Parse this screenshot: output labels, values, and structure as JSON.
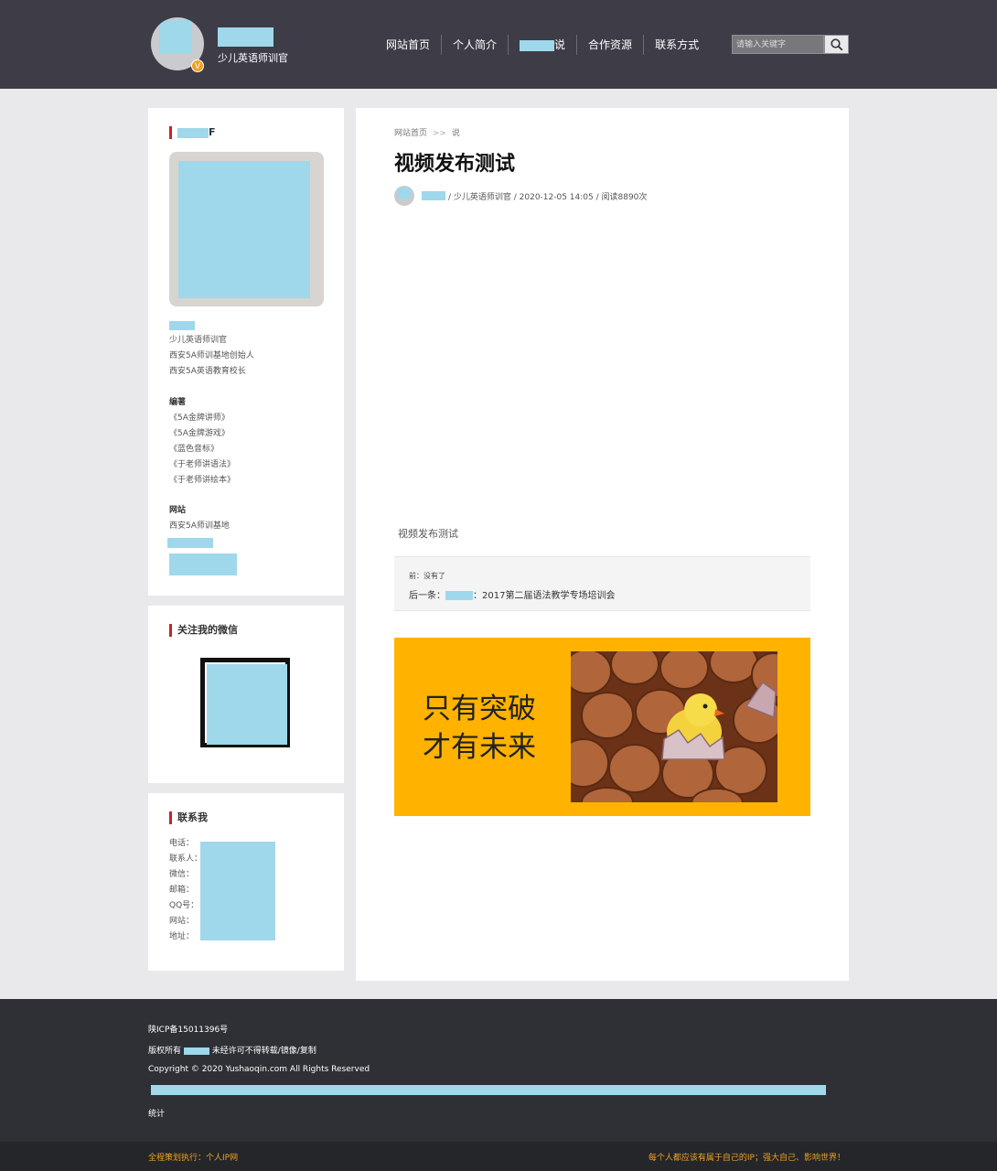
{
  "header": {
    "subtitle": "少儿英语师训官",
    "badge": "V",
    "nav": [
      "网站首页",
      "个人简介",
      "说",
      "合作资源",
      "联系方式"
    ],
    "search_placeholder": "请输入关键字"
  },
  "sidebar": {
    "profile": {
      "title_tail": "F",
      "lines": [
        "少儿英语师训官",
        "西安5A师训基地创始人",
        "西安5A英语教育校长"
      ],
      "books_heading": "编著",
      "books": [
        "《5A金牌讲师》",
        "《5A金牌游戏》",
        "《蓝色音标》",
        "《于老师讲语法》",
        "《于老师讲绘本》"
      ],
      "sites_heading": "网站",
      "sites": [
        "西安5A师训基地"
      ]
    },
    "wechat": {
      "title": "关注我的微信"
    },
    "contact": {
      "title": "联系我",
      "labels": [
        "电话：",
        "联系人：",
        "微信：",
        "邮箱：",
        "QQ号：",
        "网站：",
        "地址："
      ]
    }
  },
  "article": {
    "breadcrumb_home": "网站首页",
    "breadcrumb_sep": ">>",
    "breadcrumb_current": "说",
    "title": "视频发布测试",
    "meta": "/ 少儿英语师训官 / 2020-12-05 14:05 / 阅读8890次",
    "caption": "视频发布测试",
    "prev": "前：没有了",
    "next_label": "后一条：",
    "next_title": "：2017第二届语法教学专场培训会",
    "banner_line1": "只有突破",
    "banner_line2": "才有未来"
  },
  "footer": {
    "icp": "陕ICP备15011396号",
    "rights_prefix": "版权所有",
    "rights_suffix": "未经许可不得转载/镜像/复制",
    "copyright": "Copyright © 2020 Yushaoqin.com All Rights Reserved",
    "stats": "统计",
    "bottom_left": "全程策划执行：个人IP网",
    "bottom_right": "每个人都应该有属于自己的IP；强大自己、影响世界！"
  },
  "colors": {
    "header_bg": "#3d3c47",
    "accent_red": "#c9232b",
    "banner_yellow": "#ffb300",
    "footer_orange": "#f0a021"
  }
}
